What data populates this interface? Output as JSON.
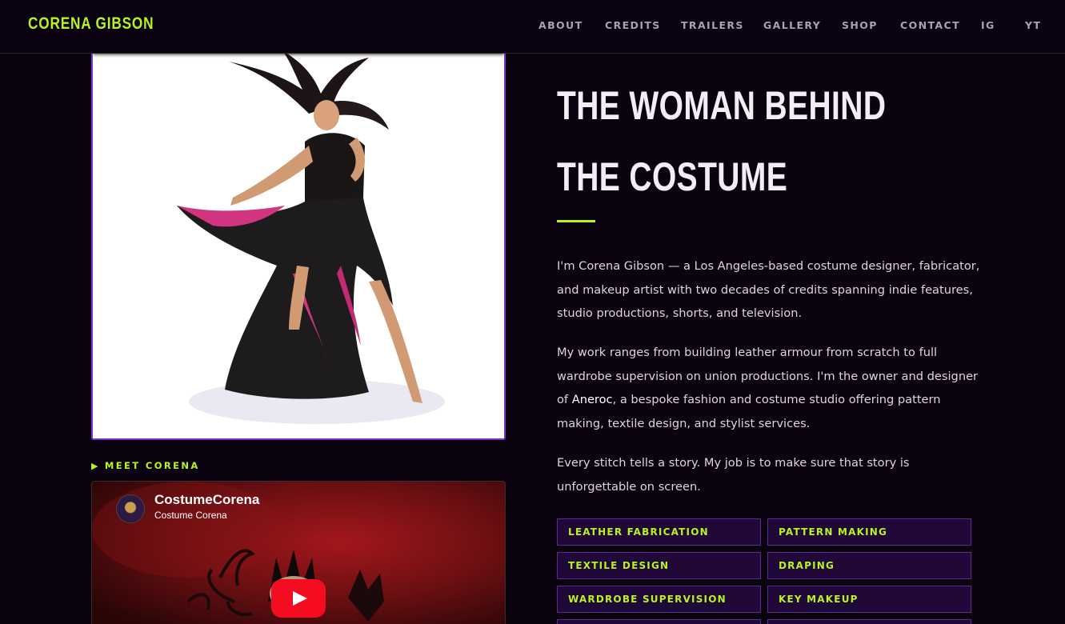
{
  "nav": {
    "brand": "CORENA GIBSON",
    "links": [
      "ABOUT",
      "CREDITS",
      "TRAILERS",
      "GALLERY",
      "SHOP",
      "CONTACT",
      "IG",
      "YT"
    ]
  },
  "meet_label": "MEET CORENA",
  "video": {
    "channel_name": "CostumeCorena",
    "channel_sub": "Costume Corena"
  },
  "headline": "THE WOMAN BEHIND THE COSTUME",
  "paragraphs": {
    "p1": "I'm Corena Gibson — a Los Angeles-based costume designer, fabricator, and makeup artist with two decades of credits spanning indie features, studio productions, shorts, and television.",
    "p2_before": "My work ranges from building leather armour from scratch to full wardrobe supervision on union productions. I'm the owner and designer of ",
    "p2_brand": "Aneroc",
    "p2_after": ", a bespoke fashion and costume studio offering pattern making, textile design, and stylist services.",
    "p3": "Every stitch tells a story. My job is to make sure that story is unforgettable on screen."
  },
  "skills": [
    "LEATHER FABRICATION",
    "PATTERN MAKING",
    "TEXTILE DESIGN",
    "DRAPING",
    "WARDROBE SUPERVISION",
    "KEY MAKEUP"
  ],
  "colors": {
    "accent": "#b8f41c",
    "background": "#0c0310",
    "frame": "#7b34c9",
    "skill_bg": "#200838",
    "youtube_red": "#f40d20"
  }
}
